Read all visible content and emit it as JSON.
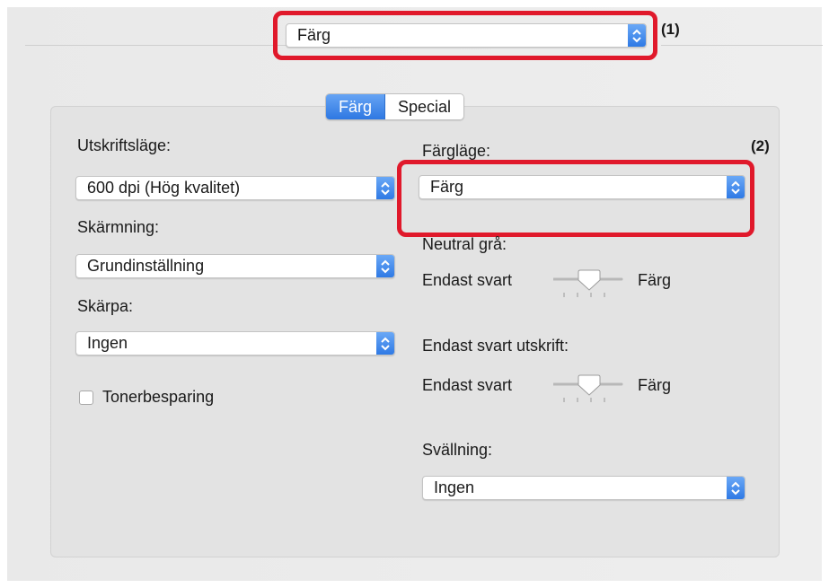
{
  "top_selector": {
    "value": "Färg",
    "callout": "(1)"
  },
  "tabs": [
    {
      "label": "Färg",
      "active": true
    },
    {
      "label": "Special",
      "active": false
    }
  ],
  "left_column": {
    "print_mode": {
      "label": "Utskriftsläge:",
      "value": "600 dpi (Hög kvalitet)"
    },
    "screening": {
      "label": "Skärmning:",
      "value": "Grundinställning"
    },
    "sharpness": {
      "label": "Skärpa:",
      "value": "Ingen"
    },
    "toner_save": {
      "label": "Tonerbesparing",
      "checked": false
    }
  },
  "right_column": {
    "color_mode": {
      "label": "Färgläge:",
      "value": "Färg",
      "callout": "(2)"
    },
    "neutral_gray": {
      "label": "Neutral grå:",
      "min_label": "Endast svart",
      "max_label": "Färg",
      "level": 0.5
    },
    "black_only_print": {
      "label": "Endast svart utskrift:",
      "min_label": "Endast svart",
      "max_label": "Färg",
      "level": 0.5
    },
    "trapping": {
      "label": "Svällning:",
      "value": "Ingen"
    }
  },
  "colors": {
    "accent": "#3b82ea",
    "callout": "#e0192b"
  }
}
